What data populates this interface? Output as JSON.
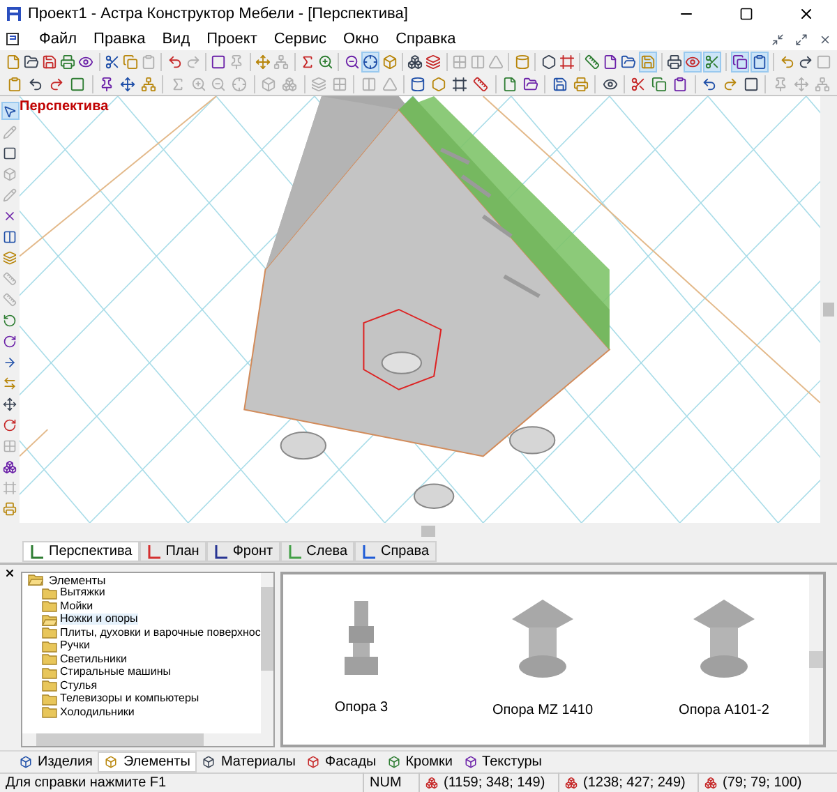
{
  "window": {
    "title": "Проект1 - Астра Конструктор Мебели - [Перспектива]"
  },
  "menu": [
    "Файл",
    "Правка",
    "Вид",
    "Проект",
    "Сервис",
    "Окно",
    "Справка"
  ],
  "toolbar_1": [
    {
      "kind": "button",
      "pressed": false,
      "disabled": false
    },
    {
      "kind": "button",
      "pressed": false,
      "disabled": false
    },
    {
      "kind": "button",
      "pressed": false,
      "disabled": false
    },
    {
      "kind": "button",
      "pressed": false,
      "disabled": false
    },
    {
      "kind": "button",
      "pressed": false,
      "disabled": false
    },
    {
      "kind": "separator"
    },
    {
      "kind": "button",
      "pressed": false,
      "disabled": false
    },
    {
      "kind": "button",
      "pressed": false,
      "disabled": false
    },
    {
      "kind": "button",
      "pressed": false,
      "disabled": true
    },
    {
      "kind": "separator"
    },
    {
      "kind": "button",
      "pressed": false,
      "disabled": false
    },
    {
      "kind": "button",
      "pressed": false,
      "disabled": true
    },
    {
      "kind": "separator"
    },
    {
      "kind": "button",
      "pressed": false,
      "disabled": false
    },
    {
      "kind": "button",
      "pressed": false,
      "disabled": true
    },
    {
      "kind": "separator"
    },
    {
      "kind": "button",
      "pressed": false,
      "disabled": false
    },
    {
      "kind": "button",
      "pressed": false,
      "disabled": true
    },
    {
      "kind": "separator"
    },
    {
      "kind": "button",
      "pressed": false,
      "disabled": false
    },
    {
      "kind": "button",
      "pressed": false,
      "disabled": false
    },
    {
      "kind": "separator"
    },
    {
      "kind": "button",
      "pressed": false,
      "disabled": false
    },
    {
      "kind": "button",
      "pressed": true,
      "disabled": false
    },
    {
      "kind": "button",
      "pressed": false,
      "disabled": false
    },
    {
      "kind": "separator"
    },
    {
      "kind": "button",
      "pressed": false,
      "disabled": false
    },
    {
      "kind": "button",
      "pressed": false,
      "disabled": false
    },
    {
      "kind": "separator"
    },
    {
      "kind": "button",
      "pressed": false,
      "disabled": true
    },
    {
      "kind": "button",
      "pressed": false,
      "disabled": true
    },
    {
      "kind": "button",
      "pressed": false,
      "disabled": true
    },
    {
      "kind": "separator"
    },
    {
      "kind": "button",
      "pressed": false,
      "disabled": false
    },
    {
      "kind": "separator"
    },
    {
      "kind": "button",
      "pressed": false,
      "disabled": false
    },
    {
      "kind": "button",
      "pressed": false,
      "disabled": false
    },
    {
      "kind": "separator"
    },
    {
      "kind": "button",
      "pressed": false,
      "disabled": false
    },
    {
      "kind": "button",
      "pressed": false,
      "disabled": false
    },
    {
      "kind": "button",
      "pressed": false,
      "disabled": false
    },
    {
      "kind": "button",
      "pressed": true,
      "disabled": false
    },
    {
      "kind": "separator"
    },
    {
      "kind": "button",
      "pressed": false,
      "disabled": false
    },
    {
      "kind": "button",
      "pressed": true,
      "disabled": false
    },
    {
      "kind": "button",
      "pressed": true,
      "disabled": false
    },
    {
      "kind": "separator"
    },
    {
      "kind": "button",
      "pressed": true,
      "disabled": false
    },
    {
      "kind": "button",
      "pressed": true,
      "disabled": false
    },
    {
      "kind": "separator"
    },
    {
      "kind": "button",
      "pressed": false,
      "disabled": false
    },
    {
      "kind": "button",
      "pressed": false,
      "disabled": false
    },
    {
      "kind": "button",
      "pressed": false,
      "disabled": true
    }
  ],
  "toolbar_2": [
    {
      "kind": "button",
      "pressed": false,
      "disabled": false
    },
    {
      "kind": "button",
      "pressed": false,
      "disabled": false
    },
    {
      "kind": "button",
      "pressed": false,
      "disabled": false
    },
    {
      "kind": "button",
      "pressed": false,
      "disabled": false
    },
    {
      "kind": "separator"
    },
    {
      "kind": "button",
      "pressed": false,
      "disabled": false
    },
    {
      "kind": "button",
      "pressed": false,
      "disabled": false
    },
    {
      "kind": "button",
      "pressed": false,
      "disabled": false
    },
    {
      "kind": "separator"
    },
    {
      "kind": "button",
      "pressed": false,
      "disabled": true
    },
    {
      "kind": "button",
      "pressed": false,
      "disabled": true
    },
    {
      "kind": "button",
      "pressed": false,
      "disabled": true
    },
    {
      "kind": "button",
      "pressed": false,
      "disabled": true
    },
    {
      "kind": "separator"
    },
    {
      "kind": "button",
      "pressed": false,
      "disabled": true
    },
    {
      "kind": "button",
      "pressed": false,
      "disabled": true
    },
    {
      "kind": "separator"
    },
    {
      "kind": "button",
      "pressed": false,
      "disabled": true
    },
    {
      "kind": "button",
      "pressed": false,
      "disabled": true
    },
    {
      "kind": "separator"
    },
    {
      "kind": "button",
      "pressed": false,
      "disabled": true
    },
    {
      "kind": "button",
      "pressed": false,
      "disabled": true
    },
    {
      "kind": "separator"
    },
    {
      "kind": "button",
      "pressed": false,
      "disabled": false
    },
    {
      "kind": "button",
      "pressed": false,
      "disabled": false
    },
    {
      "kind": "button",
      "pressed": false,
      "disabled": false
    },
    {
      "kind": "button",
      "pressed": false,
      "disabled": false
    },
    {
      "kind": "separator"
    },
    {
      "kind": "button",
      "pressed": false,
      "disabled": false
    },
    {
      "kind": "button",
      "pressed": false,
      "disabled": false
    },
    {
      "kind": "separator"
    },
    {
      "kind": "button",
      "pressed": false,
      "disabled": false
    },
    {
      "kind": "button",
      "pressed": false,
      "disabled": false
    },
    {
      "kind": "separator"
    },
    {
      "kind": "button",
      "pressed": false,
      "disabled": false
    },
    {
      "kind": "separator"
    },
    {
      "kind": "button",
      "pressed": false,
      "disabled": false
    },
    {
      "kind": "button",
      "pressed": false,
      "disabled": false
    },
    {
      "kind": "button",
      "pressed": false,
      "disabled": false
    },
    {
      "kind": "separator"
    },
    {
      "kind": "button",
      "pressed": false,
      "disabled": false
    },
    {
      "kind": "button",
      "pressed": false,
      "disabled": false
    },
    {
      "kind": "button",
      "pressed": false,
      "disabled": false
    },
    {
      "kind": "separator"
    },
    {
      "kind": "button",
      "pressed": false,
      "disabled": true
    },
    {
      "kind": "button",
      "pressed": false,
      "disabled": true
    },
    {
      "kind": "button",
      "pressed": false,
      "disabled": true
    }
  ],
  "left_toolbar": [
    {
      "pressed": true,
      "disabled": false
    },
    {
      "pressed": false,
      "disabled": true
    },
    {
      "pressed": false,
      "disabled": false
    },
    {
      "pressed": false,
      "disabled": true
    },
    {
      "pressed": false,
      "disabled": true
    },
    {
      "pressed": false,
      "disabled": false
    },
    {
      "pressed": false,
      "disabled": false
    },
    {
      "pressed": false,
      "disabled": false
    },
    {
      "pressed": false,
      "disabled": true
    },
    {
      "pressed": false,
      "disabled": true
    },
    {
      "pressed": false,
      "disabled": false
    },
    {
      "pressed": false,
      "disabled": false
    },
    {
      "pressed": false,
      "disabled": false
    },
    {
      "pressed": false,
      "disabled": false
    },
    {
      "pressed": false,
      "disabled": false
    },
    {
      "pressed": false,
      "disabled": false
    },
    {
      "pressed": false,
      "disabled": true
    },
    {
      "pressed": false,
      "disabled": false
    },
    {
      "pressed": false,
      "disabled": true
    },
    {
      "pressed": false,
      "disabled": false
    }
  ],
  "viewport": {
    "label": "Перспектива"
  },
  "view_tabs": [
    {
      "label": "Перспектива",
      "selected": true,
      "color": "#2e7d32"
    },
    {
      "label": "План",
      "selected": false,
      "color": "#d32f2f"
    },
    {
      "label": "Фронт",
      "selected": false,
      "color": "#283593"
    },
    {
      "label": "Слева",
      "selected": false,
      "color": "#43a047"
    },
    {
      "label": "Справа",
      "selected": false,
      "color": "#1e5bd6"
    }
  ],
  "tree": {
    "label": "Элементы",
    "expanded": true,
    "children": [
      {
        "label": "Вытяжки",
        "selected": false
      },
      {
        "label": "Мойки",
        "selected": false
      },
      {
        "label": "Ножки и опоры",
        "selected": true
      },
      {
        "label": "Плиты, духовки и варочные поверхнос",
        "selected": false
      },
      {
        "label": "Ручки",
        "selected": false
      },
      {
        "label": "Светильники",
        "selected": false
      },
      {
        "label": "Стиральные машины",
        "selected": false
      },
      {
        "label": "Стулья",
        "selected": false
      },
      {
        "label": "Телевизоры и компьютеры",
        "selected": false
      },
      {
        "label": "Холодильники",
        "selected": false
      }
    ]
  },
  "catalog": [
    {
      "kind": "turned",
      "label": "Опора 3"
    },
    {
      "kind": "plate",
      "label": "Опора MZ 1410"
    },
    {
      "kind": "plate",
      "label": "Опора A101-2"
    }
  ],
  "panel_tabs": [
    {
      "label": "Изделия",
      "selected": false
    },
    {
      "label": "Элементы",
      "selected": true
    },
    {
      "label": "Материалы",
      "selected": false
    },
    {
      "label": "Фасады",
      "selected": false
    },
    {
      "label": "Кромки",
      "selected": false
    },
    {
      "label": "Текстуры",
      "selected": false
    }
  ],
  "status_bar": {
    "hint": "Для справки нажмите F1",
    "num": "NUM",
    "coords": [
      "(1159; 348; 149)",
      "(1238; 427; 249)",
      "(79; 79; 100)"
    ]
  }
}
